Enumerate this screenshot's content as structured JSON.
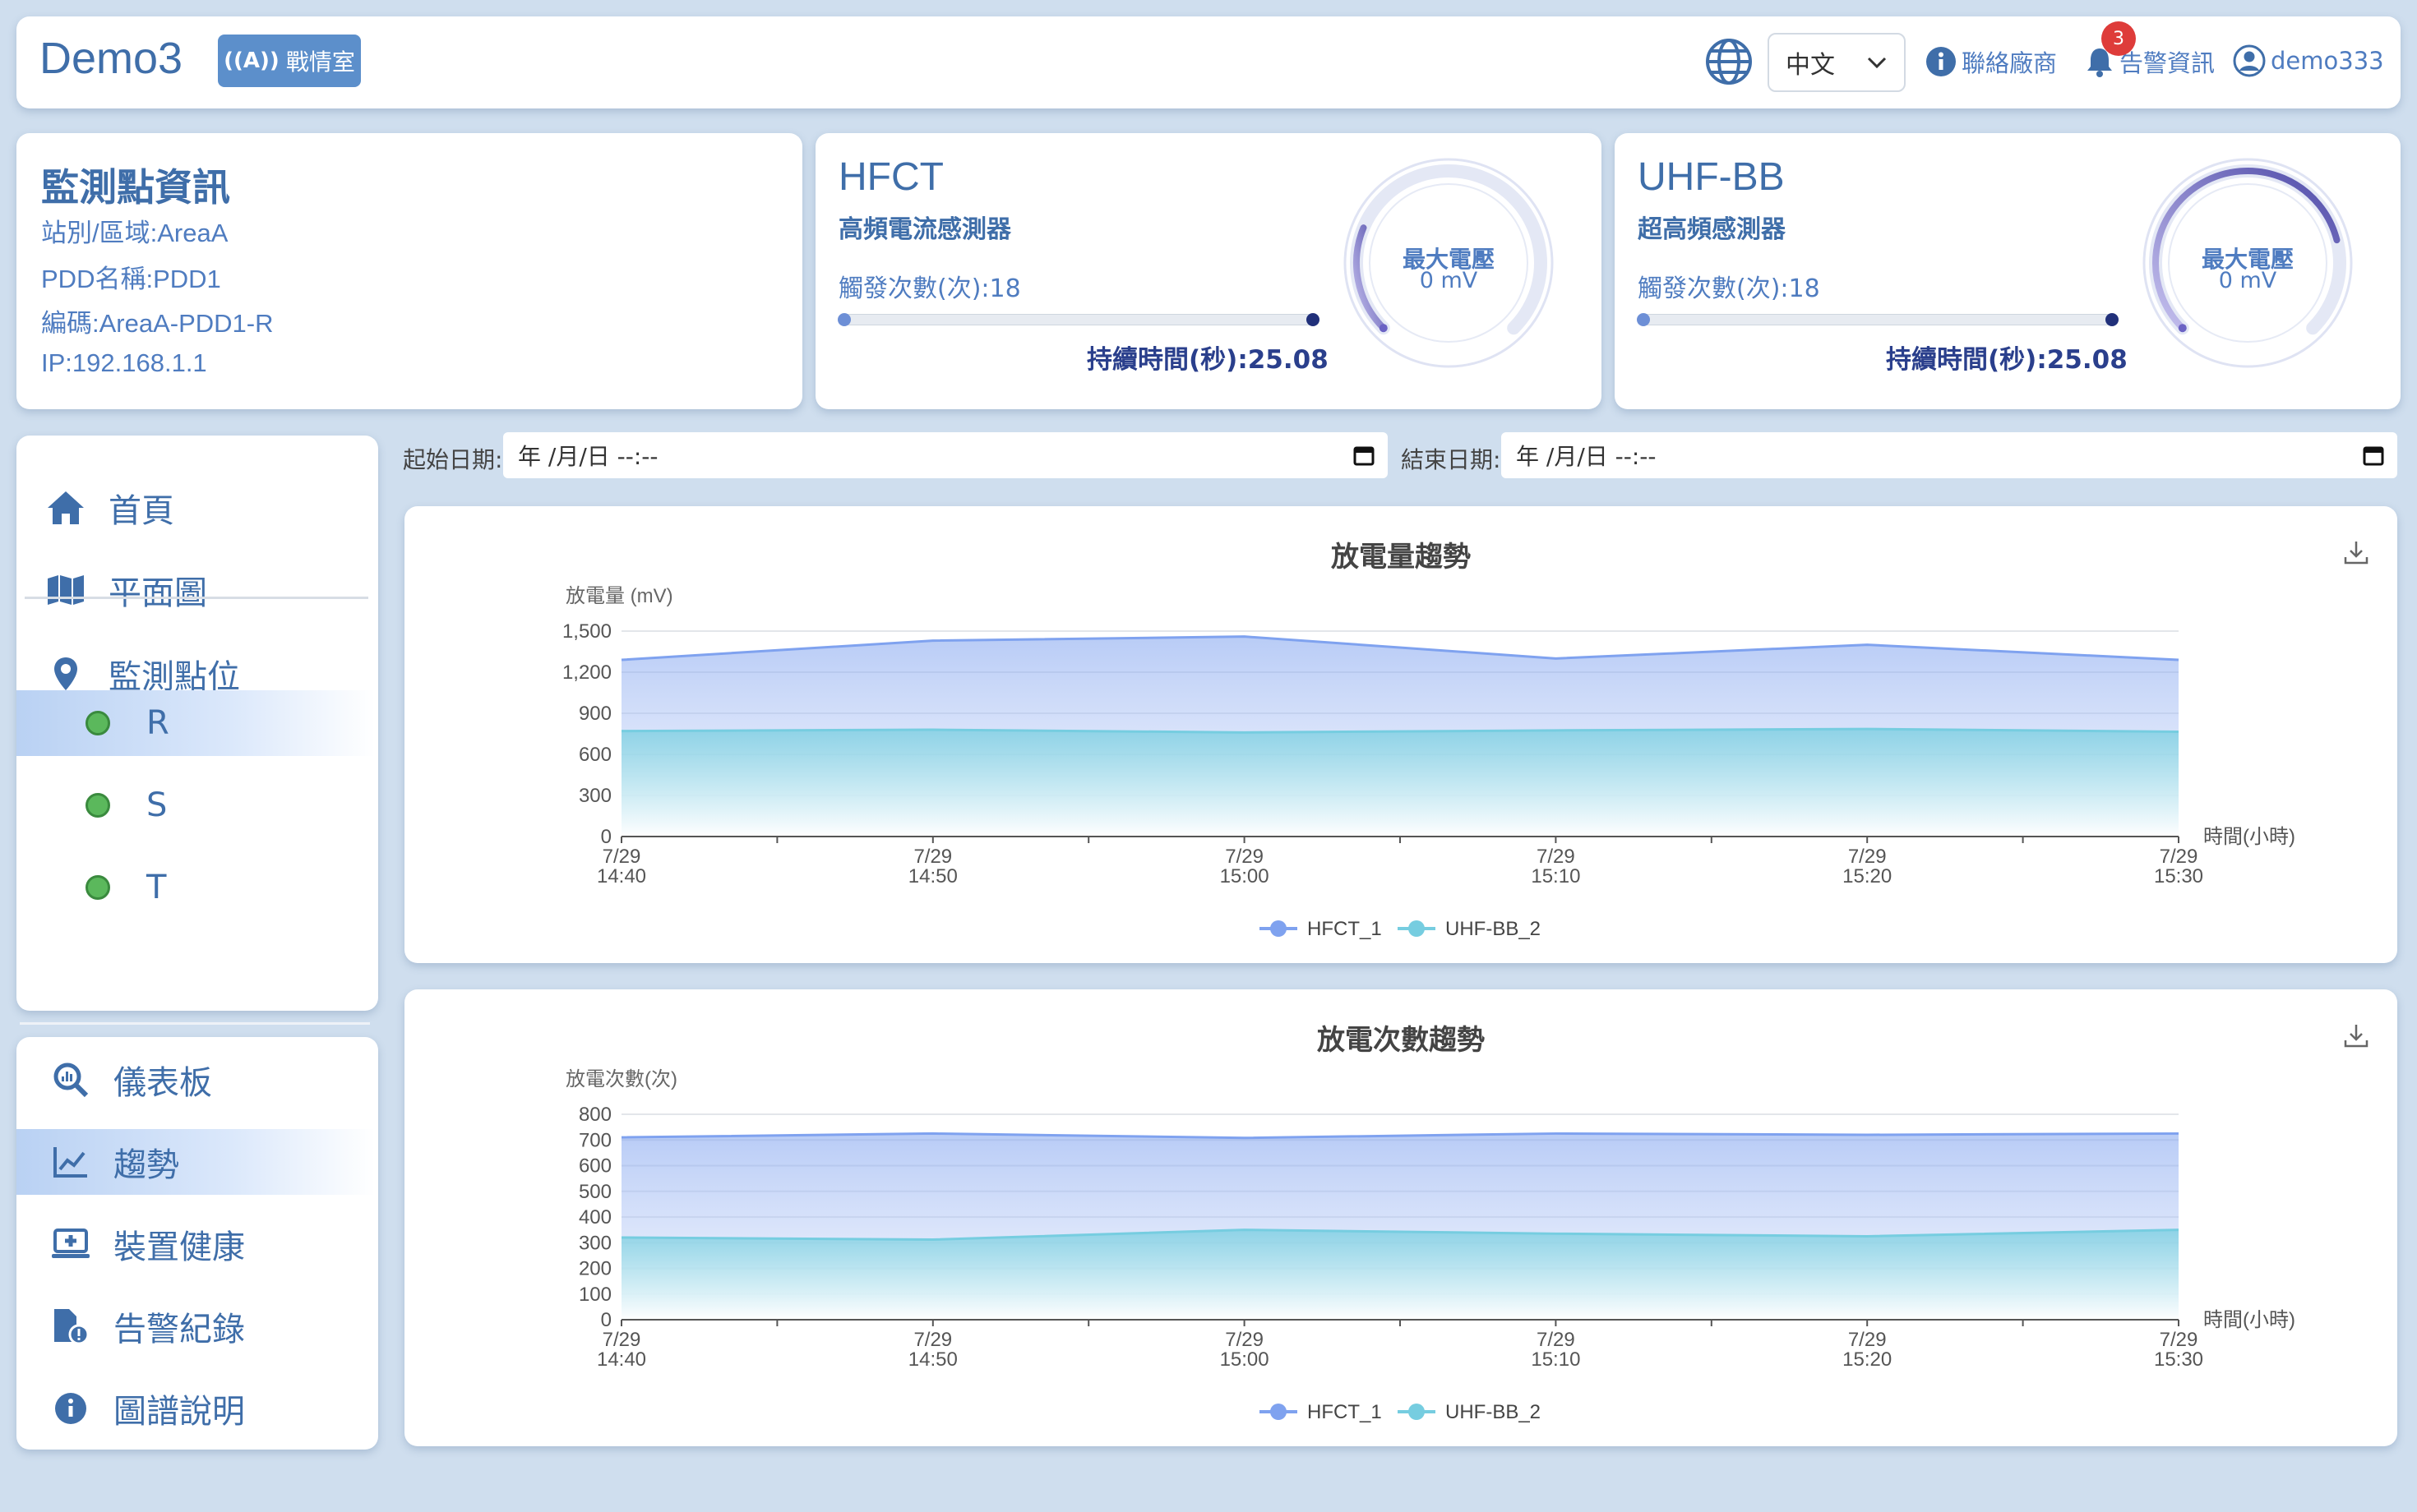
{
  "header": {
    "brand": "Demo3",
    "war_room_label": "戰情室",
    "language": "中文",
    "contact_label": "聯絡廠商",
    "alert_label": "告警資訊",
    "alert_count": "3",
    "user_label": "demo333"
  },
  "site_info": {
    "title": "監測點資訊",
    "station": "站別/區域:AreaA",
    "pdd": "PDD名稱:PDD1",
    "code": "編碼:AreaA-PDD1-R",
    "ip": "IP:192.168.1.1"
  },
  "sensors": [
    {
      "name": "HFCT",
      "subtitle": "高頻電流感測器",
      "trigger_text": "觸發次數(次):18",
      "duration_text": "持續時間(秒):25.08",
      "gauge_label": "最大電壓",
      "gauge_value": "0 mV",
      "gauge_fraction": 0.25
    },
    {
      "name": "UHF-BB",
      "subtitle": "超高頻感測器",
      "trigger_text": "觸發次數(次):18",
      "duration_text": "持續時間(秒):25.08",
      "gauge_label": "最大電壓",
      "gauge_value": "0 mV",
      "gauge_fraction": 0.78
    }
  ],
  "nav_top": {
    "home": "首頁",
    "floorplan": "平面圖",
    "monitor_points": "監測點位",
    "points": [
      "R",
      "S",
      "T"
    ],
    "active_point": "R"
  },
  "nav_bottom": {
    "dashboard": "儀表板",
    "trend": "趨勢",
    "device_health": "裝置健康",
    "alert_records": "告警紀錄",
    "legend_help": "圖譜說明",
    "active": "趨勢"
  },
  "filters": {
    "start_label": "起始日期:",
    "end_label": "結束日期:",
    "start_value": "年 /月/日 --:--",
    "end_value": "年 /月/日 --:--"
  },
  "chart_data": [
    {
      "type": "area",
      "title": "放電量趨勢",
      "ylabel": "放電量 (mV)",
      "xlabel": "時間(小時)",
      "x": [
        "7/29\n14:40",
        "7/29\n14:50",
        "7/29\n15:00",
        "7/29\n15:10",
        "7/29\n15:20",
        "7/29\n15:30"
      ],
      "ylim": [
        0,
        1500
      ],
      "yticks": [
        "0",
        "300",
        "600",
        "900",
        "1,200",
        "1,500"
      ],
      "series": [
        {
          "name": "HFCT_1",
          "color": "#7fa2ef",
          "values": [
            1290,
            1430,
            1460,
            1300,
            1400,
            1290
          ]
        },
        {
          "name": "UHF-BB_2",
          "color": "#76cde0",
          "values": [
            770,
            780,
            760,
            775,
            785,
            765
          ]
        }
      ],
      "legend": "bottom",
      "grid": true
    },
    {
      "type": "area",
      "title": "放電次數趨勢",
      "ylabel": "放電次數(次)",
      "xlabel": "時間(小時)",
      "x": [
        "7/29\n14:40",
        "7/29\n14:50",
        "7/29\n15:00",
        "7/29\n15:10",
        "7/29\n15:20",
        "7/29\n15:30"
      ],
      "ylim": [
        0,
        800
      ],
      "yticks": [
        "0",
        "100",
        "200",
        "300",
        "400",
        "500",
        "600",
        "700",
        "800"
      ],
      "series": [
        {
          "name": "HFCT_1",
          "color": "#7fa2ef",
          "values": [
            710,
            725,
            708,
            725,
            720,
            725
          ]
        },
        {
          "name": "UHF-BB_2",
          "color": "#76cde0",
          "values": [
            320,
            312,
            350,
            335,
            325,
            350
          ]
        }
      ],
      "legend": "bottom",
      "grid": true
    }
  ]
}
